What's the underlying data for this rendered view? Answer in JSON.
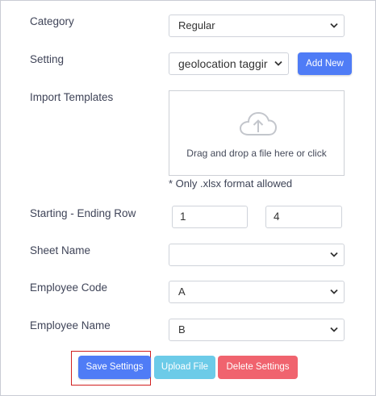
{
  "form": {
    "category": {
      "label": "Category",
      "value": "Regular"
    },
    "setting": {
      "label": "Setting",
      "value": "geolocation taggir",
      "add_new_label": "Add New"
    },
    "import_templates": {
      "label": "Import Templates",
      "dropzone_text": "Drag and drop a file here or click",
      "hint": "* Only .xlsx format allowed",
      "icon": "cloud-upload-icon"
    },
    "row_range": {
      "label": "Starting - Ending Row",
      "start": "1",
      "end": "4"
    },
    "sheet_name": {
      "label": "Sheet Name",
      "value": ""
    },
    "employee_code": {
      "label": "Employee Code",
      "value": "A"
    },
    "employee_name": {
      "label": "Employee Name",
      "value": "B"
    }
  },
  "actions": {
    "save_label": "Save Settings",
    "upload_label": "Upload File",
    "delete_label": "Delete Settings"
  },
  "colors": {
    "primary": "#4f7cf6",
    "info": "#6ccbe8",
    "danger": "#f0636e",
    "highlight": "#d11f1f"
  }
}
